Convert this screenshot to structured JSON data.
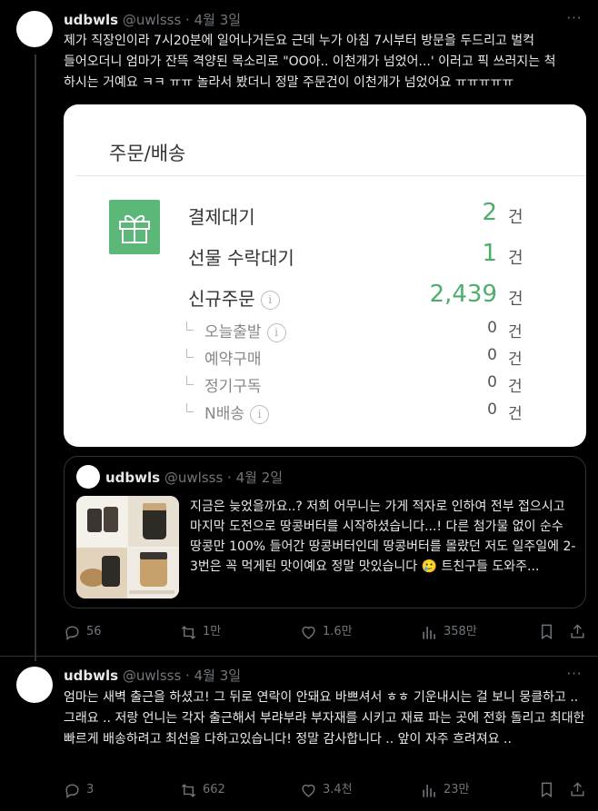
{
  "posts": [
    {
      "display_name": "udbwls",
      "handle": "@uwlsss",
      "dot": "·",
      "date": "4월 3일",
      "text": "제가 직장인이라 7시20분에 일어나거든요 근데 누가 아침 7시부터 방문을 두드리고 벌컥 들어오더니 엄마가 잔뜩 격양된 목소리로 \"OO아.. 이천개가 넘었어...' 이러고 픽 쓰러지는 척 하시는 거예요 ㅋㅋ ㅠㅠ 놀라서 봤더니 정말 주문건이 이천개가 넘었어요 ㅠㅠㅠㅠㅠ",
      "screenshot": {
        "title": "주문/배송",
        "rows": [
          {
            "label": "결제대기",
            "value": "2",
            "unit": "건"
          },
          {
            "label": "선물 수락대기",
            "value": "1",
            "unit": "건"
          },
          {
            "label": "신규주문",
            "value": "2,439",
            "unit": "건"
          },
          {
            "label": "오늘출발",
            "value": "0",
            "unit": "건"
          },
          {
            "label": "예약구매",
            "value": "0",
            "unit": "건"
          },
          {
            "label": "정기구독",
            "value": "0",
            "unit": "건"
          },
          {
            "label": "N배송",
            "value": "0",
            "unit": "건"
          }
        ]
      },
      "quote": {
        "display_name": "udbwls",
        "handle": "@uwlsss",
        "dot": "·",
        "date": "4월 2일",
        "text": "지금은 늦었을까요..? 저희 어무니는 가게 적자로 인하여 전부 접으시고 마지막 도전으로 땅콩버터를 시작하셨습니다...! 다른 첨가물 없이 순수 땅콩만 100% 들어간 땅콩버터인데 땅콩버터를 몰랐던 저도 일주일에 2-3번은 꼭 먹게된 맛이예요 정말 맛있습니다 🥲 트친구들 도와주..."
      },
      "actions": {
        "replies": "56",
        "reposts": "1만",
        "likes": "1.6만",
        "views": "358만"
      }
    },
    {
      "display_name": "udbwls",
      "handle": "@uwlsss",
      "dot": "·",
      "date": "4월 3일",
      "text": "엄마는 새벽 출근을 하셨고! 그 뒤로 연락이 안돼요 바쁘셔서 ㅎㅎ 기운내시는 걸 보니 뭉클하고 .. 그래요 .. 저랑 언니는 각자 출근해서 부랴부랴 부자재를 시키고 재료 파는 곳에 전화 돌리고 최대한 빠르게 배송하려고 최선을 다하고있습니다! 정말 감사합니다 .. 앞이 자주 흐려져요 ..",
      "actions": {
        "replies": "3",
        "reposts": "662",
        "likes": "3.4천",
        "views": "23만"
      }
    }
  ],
  "colors": {
    "background": "#000000",
    "text": "#e7e9ea",
    "muted": "#71767b",
    "accent_green": "#4fad6b",
    "gift_green": "#5cb878"
  }
}
